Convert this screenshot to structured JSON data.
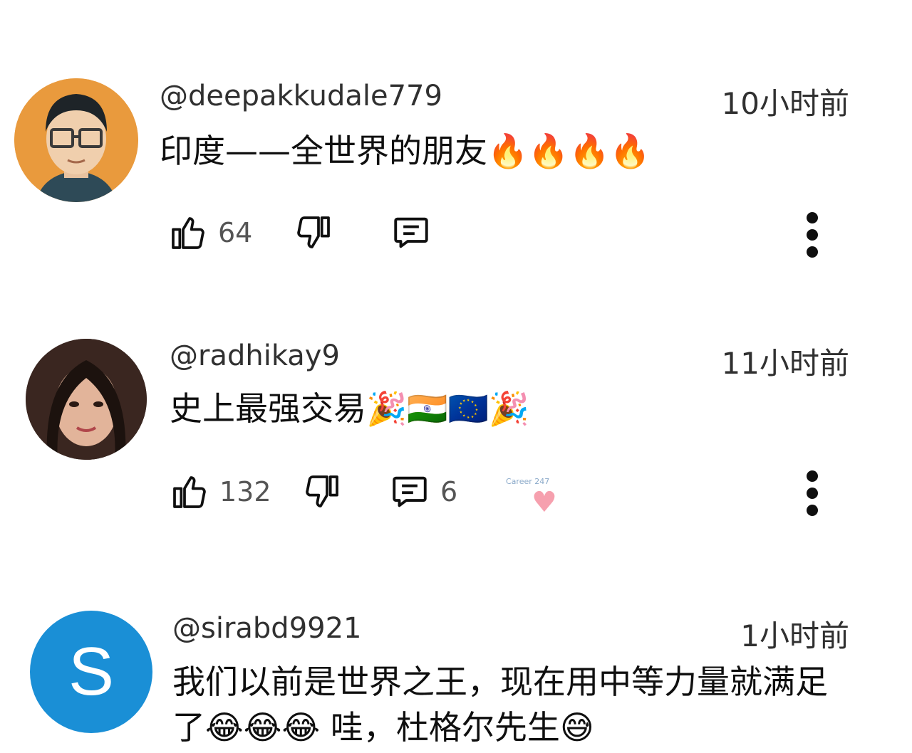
{
  "comments": [
    {
      "handle": "@deepakkudale779",
      "time": "10小时前",
      "text": "印度——全世界的朋友🔥🔥🔥🔥",
      "likes": "64",
      "replies": ""
    },
    {
      "handle": "@radhikay9",
      "time": "11小时前",
      "text": "史上最强交易🎉🇮🇳🇪🇺🎉",
      "likes": "132",
      "replies": "6",
      "creator_heart_label": "Career 247"
    },
    {
      "handle": "@sirabd9921",
      "time": "1小时前",
      "text": "我们以前是世界之王，现在用中等力量就满足了😂😂😂 哇，杜格尔先生😅",
      "avatar_letter": "S"
    }
  ],
  "colors": {
    "avatar_s": "#1a8fd6",
    "heart": "#f6a0ae"
  },
  "icons": [
    "like-icon",
    "dislike-icon",
    "reply-icon",
    "more-vert-icon",
    "heart-icon"
  ]
}
